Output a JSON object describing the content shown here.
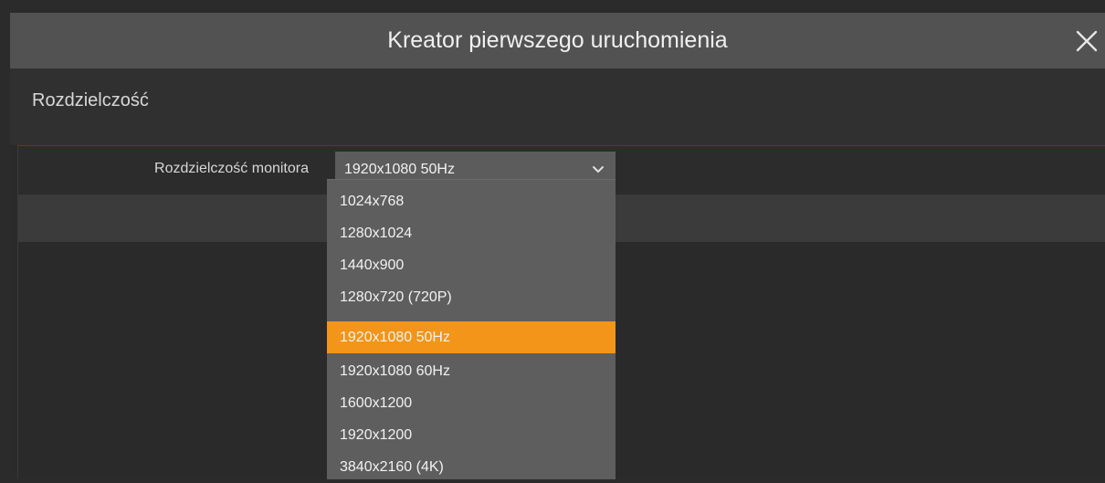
{
  "dialog": {
    "title": "Kreator pierwszego uruchomienia",
    "close_icon": "close-icon"
  },
  "section": {
    "title": "Rozdzielczość"
  },
  "monitor_resolution": {
    "label": "Rozdzielczość monitora",
    "selected_value": "1920x1080 50Hz",
    "options": [
      "1024x768",
      "1280x1024",
      "1440x900",
      "1280x720 (720P)",
      "1920x1080 50Hz",
      "1920x1080 60Hz",
      "1600x1200",
      "1920x1200",
      "3840x2160 (4K)"
    ],
    "selected_index": 4
  },
  "colors": {
    "accent": "#f39519",
    "titlebar": "#525252",
    "dropdown_bg": "#5e5e5e",
    "background": "#2a2a2a"
  }
}
